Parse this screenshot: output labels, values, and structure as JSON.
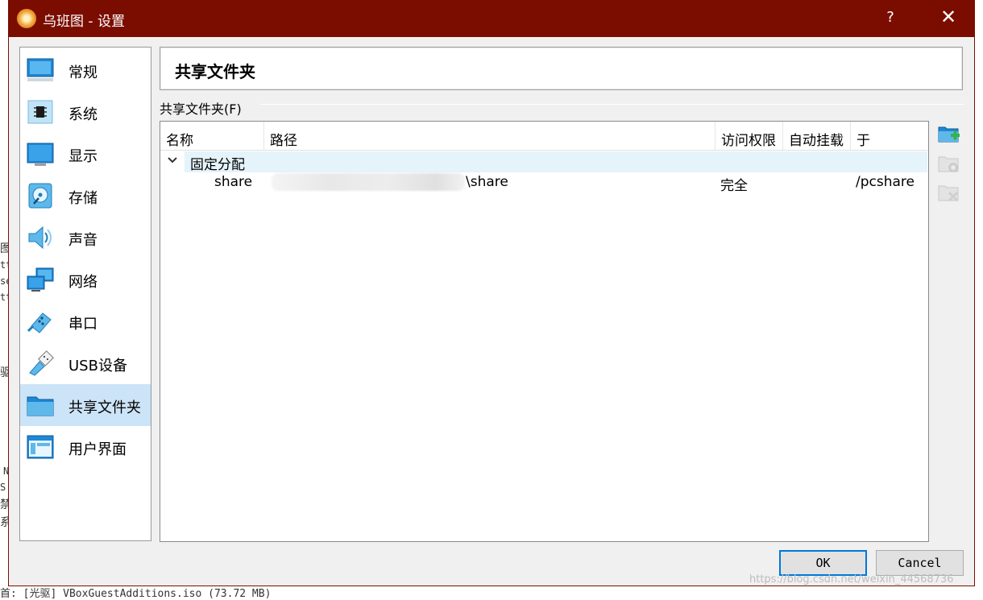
{
  "window": {
    "title": "乌班图 - 设置",
    "help": "?",
    "close": "✕"
  },
  "background": {
    "left_fragments": [
      "图",
      "tt",
      "se",
      "tt",
      "驱",
      "N",
      "S",
      "禁",
      "系"
    ],
    "bottom_text": "首: [光驱] VBoxGuestAdditions.iso (73.72 MB)"
  },
  "sidebar": {
    "items": [
      {
        "label": "常规",
        "icon": "monitor-icon"
      },
      {
        "label": "系统",
        "icon": "chip-icon"
      },
      {
        "label": "显示",
        "icon": "display-icon"
      },
      {
        "label": "存储",
        "icon": "disk-icon"
      },
      {
        "label": "声音",
        "icon": "speaker-icon"
      },
      {
        "label": "网络",
        "icon": "network-icon"
      },
      {
        "label": "串口",
        "icon": "serial-port-icon"
      },
      {
        "label": "USB设备",
        "icon": "usb-icon"
      },
      {
        "label": "共享文件夹",
        "icon": "folder-icon",
        "selected": true
      },
      {
        "label": "用户界面",
        "icon": "ui-window-icon"
      }
    ]
  },
  "main": {
    "header": "共享文件夹",
    "group_label": "共享文件夹(F)",
    "table": {
      "columns": [
        "名称",
        "路径",
        "访问权限",
        "自动挂载",
        "于"
      ],
      "group": "固定分配",
      "rows": [
        {
          "name": "share",
          "path": "\\share",
          "access": "完全",
          "automount": "",
          "at": "/pcshare"
        }
      ]
    }
  },
  "toolbar": {
    "add": "add-shared-folder-icon",
    "edit": "edit-shared-folder-icon",
    "remove": "remove-shared-folder-icon"
  },
  "buttons": {
    "ok": "OK",
    "cancel": "Cancel"
  },
  "watermark": "https://blog.csdn.net/weixin_44568736"
}
